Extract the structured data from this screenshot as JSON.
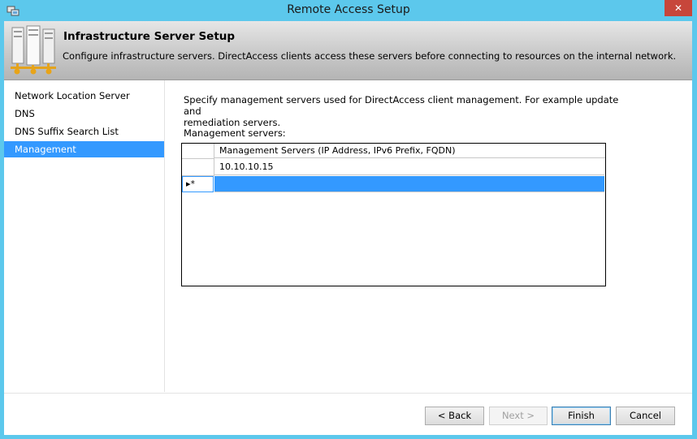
{
  "window": {
    "title": "Remote Access Setup",
    "close_glyph": "✕",
    "app_icon": "remote-access-app-icon",
    "titlebar_color": "#5cc8ec"
  },
  "banner": {
    "title": "Infrastructure Server Setup",
    "description": "Configure infrastructure servers. DirectAccess clients access these servers before connecting to resources on the internal network.",
    "icon": "server-rack-icon"
  },
  "nav": {
    "items": [
      {
        "label": "Network Location Server",
        "selected": false
      },
      {
        "label": "DNS",
        "selected": false
      },
      {
        "label": "DNS Suffix Search List",
        "selected": false
      },
      {
        "label": "Management",
        "selected": true
      }
    ],
    "selected_color": "#3399ff"
  },
  "content": {
    "instruction_line1": "Specify management servers used for DirectAccess client management. For example update and",
    "instruction_line2": "remediation servers.",
    "management_label": "Management servers:",
    "grid": {
      "column_header": "Management Servers (IP Address, IPv6 Prefix, FQDN)",
      "rows": [
        "10.10.10.15"
      ],
      "new_row_marker": "▸*",
      "new_row_value": ""
    }
  },
  "buttons": {
    "back": "< Back",
    "next": "Next >",
    "finish": "Finish",
    "cancel": "Cancel"
  }
}
